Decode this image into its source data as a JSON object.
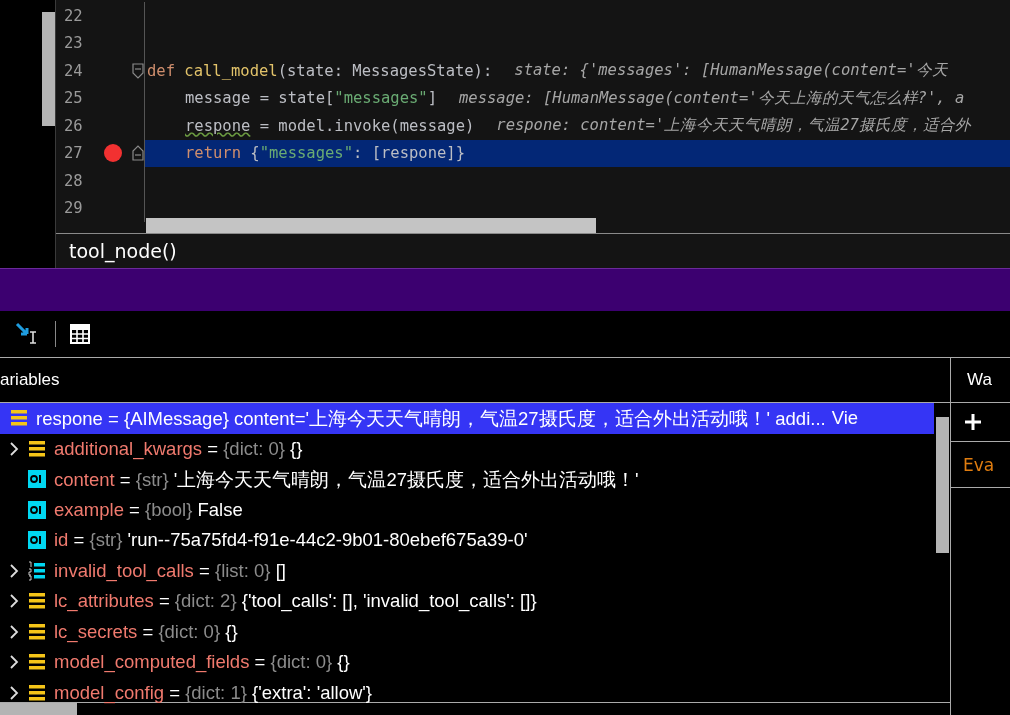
{
  "editor": {
    "lines": [
      {
        "number": "22",
        "breakpoint": false,
        "current": false
      },
      {
        "number": "23",
        "breakpoint": false,
        "current": false
      },
      {
        "number": "24",
        "breakpoint": false,
        "current": false,
        "fold_start": true,
        "tokens": [
          {
            "kind": "keyword",
            "text": "def "
          },
          {
            "kind": "function",
            "text": "call_model"
          },
          {
            "kind": "plain",
            "text": "(state: MessagesState):"
          }
        ],
        "hint": "state: {'messages': [HumanMessage(content='今天"
      },
      {
        "number": "25",
        "breakpoint": false,
        "current": false,
        "indented": true,
        "tokens": [
          {
            "kind": "plain",
            "text": "message = state["
          },
          {
            "kind": "string",
            "text": "\"messages\""
          },
          {
            "kind": "plain",
            "text": "]"
          }
        ],
        "hint": "message: [HumanMessage(content='今天上海的天气怎么样?', a"
      },
      {
        "number": "26",
        "breakpoint": false,
        "current": false,
        "indented": true,
        "tokens": [
          {
            "kind": "warning",
            "text": "respone"
          },
          {
            "kind": "plain",
            "text": " = model.invoke(message)"
          }
        ],
        "hint": "respone: content='上海今天天气晴朗，气温27摄氏度，适合外"
      },
      {
        "number": "27",
        "breakpoint": true,
        "current": true,
        "fold_end": true,
        "indented": true,
        "tokens": [
          {
            "kind": "keyword",
            "text": "return "
          },
          {
            "kind": "plain",
            "text": "{"
          },
          {
            "kind": "string",
            "text": "\"messages\""
          },
          {
            "kind": "plain",
            "text": ": [respone]}"
          }
        ]
      },
      {
        "number": "28",
        "breakpoint": false,
        "current": false
      },
      {
        "number": "29",
        "breakpoint": false,
        "current": false
      }
    ],
    "breadcrumb": "tool_node()"
  },
  "variables": {
    "title": "ariables",
    "items": [
      {
        "name": "respone",
        "operator": "=",
        "type": "{AIMessage}",
        "value": "content='上海今天天气晴朗，气温27摄氏度，适合外出活动哦！' addi...",
        "link": "Vie",
        "kind": "dict",
        "selected": true,
        "children": [
          {
            "name": "additional_kwargs",
            "operator": "=",
            "type": "{dict: 0}",
            "value": "{}",
            "kind": "dict",
            "selected": false,
            "expandable": true
          },
          {
            "name": "content",
            "operator": "=",
            "type": "{str}",
            "value": "'上海今天天气晴朗，气温27摄氏度，适合外出活动哦！'",
            "kind": "scalar",
            "selected": false,
            "expandable": false
          },
          {
            "name": "example",
            "operator": "=",
            "type": "{bool}",
            "value": "False",
            "kind": "scalar",
            "selected": false,
            "expandable": false
          },
          {
            "name": "id",
            "operator": "=",
            "type": "{str}",
            "value": "'run--75a75fd4-f91e-44c2-9b01-80ebef675a39-0'",
            "kind": "scalar",
            "selected": false,
            "expandable": false
          },
          {
            "name": "invalid_tool_calls",
            "operator": "=",
            "type": "{list: 0}",
            "value": "[]",
            "kind": "list",
            "selected": false,
            "expandable": true
          },
          {
            "name": "lc_attributes",
            "operator": "=",
            "type": "{dict: 2}",
            "value": "{'tool_calls': [], 'invalid_tool_calls': []}",
            "kind": "dict",
            "selected": false,
            "expandable": true
          },
          {
            "name": "lc_secrets",
            "operator": "=",
            "type": "{dict: 0}",
            "value": "{}",
            "kind": "dict",
            "selected": false,
            "expandable": true
          },
          {
            "name": "model_computed_fields",
            "operator": "=",
            "type": "{dict: 0}",
            "value": "{}",
            "kind": "dict",
            "selected": false,
            "expandable": true
          },
          {
            "name": "model_config",
            "operator": "=",
            "type": "{dict: 1}",
            "value": "{'extra': 'allow'}",
            "kind": "dict",
            "selected": false,
            "expandable": true
          }
        ]
      }
    ]
  },
  "watches": {
    "title": "Wa",
    "placeholder": "Eva"
  }
}
